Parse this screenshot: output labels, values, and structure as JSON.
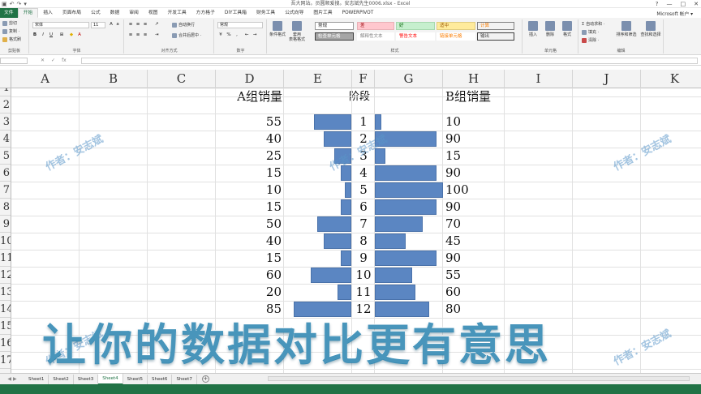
{
  "window": {
    "title": "吾大网站。员圆顺爱搜。安志斌先生0006.xlsx - Excel",
    "controls": [
      "?",
      "—",
      "□",
      "✕"
    ]
  },
  "tabs": [
    "文件",
    "开始",
    "插入",
    "页面布局",
    "公式",
    "数据",
    "审阅",
    "视图",
    "开发工具",
    "方方格子",
    "DIY工具箱",
    "财务工具",
    "公式向导",
    "图片工具",
    "POWERPIVOT"
  ],
  "active_tab": "开始",
  "account": "Microsoft 帐户 ▾",
  "ribbon": {
    "clipboard": {
      "cut": "剪切",
      "copy": "复制 ·",
      "painter": "格式刷",
      "label": "剪贴板"
    },
    "font": {
      "name": "宋体",
      "size": "11",
      "bold": "B",
      "italic": "I",
      "underline": "U",
      "label": "字体"
    },
    "alignment": {
      "wrap": "自动换行",
      "merge": "合并后居中 ·",
      "label": "对齐方式"
    },
    "number": {
      "format": "常规",
      "percent": "%",
      "comma": ",",
      "label": "数字"
    },
    "styles": {
      "conditional": "条件格式",
      "table": "套用\n表格格式",
      "cells": [
        {
          "text": "常规",
          "bg": "#ffffff",
          "color": "#222222",
          "border": "#999999"
        },
        {
          "text": "差",
          "bg": "#ffc7ce",
          "color": "#9c0006",
          "border": "#e8b0b6"
        },
        {
          "text": "好",
          "bg": "#c6efce",
          "color": "#006100",
          "border": "#a6d8ae"
        },
        {
          "text": "适中",
          "bg": "#ffeb9c",
          "color": "#9c5700",
          "border": "#e0cc80"
        },
        {
          "text": "计算",
          "bg": "#f2f2f2",
          "color": "#fa7d00",
          "border": "#7f7f7f"
        },
        {
          "text": "检查单元格",
          "bg": "#a5a5a5",
          "color": "#ffffff",
          "border": "#3f3f3f"
        },
        {
          "text": "解释性文本",
          "bg": "#ffffff",
          "color": "#7f7f7f",
          "border": "#ffffff"
        },
        {
          "text": "警告文本",
          "bg": "#ffffff",
          "color": "#ff0000",
          "border": "#ffffff"
        },
        {
          "text": "链接单元格",
          "bg": "#ffffff",
          "color": "#fa7d00",
          "border": "#ffffff"
        },
        {
          "text": "输出",
          "bg": "#f2f2f2",
          "color": "#3f3f3f",
          "border": "#3f3f3f"
        }
      ],
      "label": "样式"
    },
    "cells_group": {
      "insert": "插入",
      "delete": "删除",
      "format": "格式",
      "label": "单元格"
    },
    "editing": {
      "autosum": "自动求和 ·",
      "fill": "填充 ·",
      "clear": "清除 ·",
      "sort": "排序和筛选",
      "find": "查找和选择",
      "label": "编辑"
    }
  },
  "formula_bar": {
    "name_box": "",
    "cancel": "✕",
    "enter": "✓",
    "fx": "fx",
    "value": ""
  },
  "columns": [
    "A",
    "B",
    "C",
    "D",
    "E",
    "F",
    "G",
    "H",
    "I",
    "J",
    "K"
  ],
  "rows": [
    "1",
    "2",
    "3",
    "4",
    "5",
    "6",
    "7",
    "8",
    "9",
    "10",
    "11",
    "12",
    "13",
    "14",
    "15",
    "16",
    "17"
  ],
  "sheet": {
    "header_a": "A组销量",
    "header_stage": "阶段",
    "header_b": "B组销量",
    "a_values": [
      55,
      40,
      25,
      15,
      10,
      15,
      50,
      40,
      15,
      60,
      20,
      85
    ],
    "stages": [
      1,
      2,
      3,
      4,
      5,
      6,
      7,
      8,
      9,
      10,
      11,
      12
    ],
    "b_values": [
      10,
      90,
      15,
      90,
      100,
      90,
      70,
      45,
      90,
      55,
      60,
      80
    ],
    "bar_color": "#5b86c2"
  },
  "watermark": "作者：安志斌",
  "overlay_text": "让你的数据对比更有意思",
  "sheet_tabs": [
    "Sheet1",
    "Sheet2",
    "Sheet3",
    "Sheet4",
    "Sheet5",
    "Sheet6",
    "Sheet7"
  ],
  "active_sheet": "Sheet4",
  "add_sheet": "+"
}
